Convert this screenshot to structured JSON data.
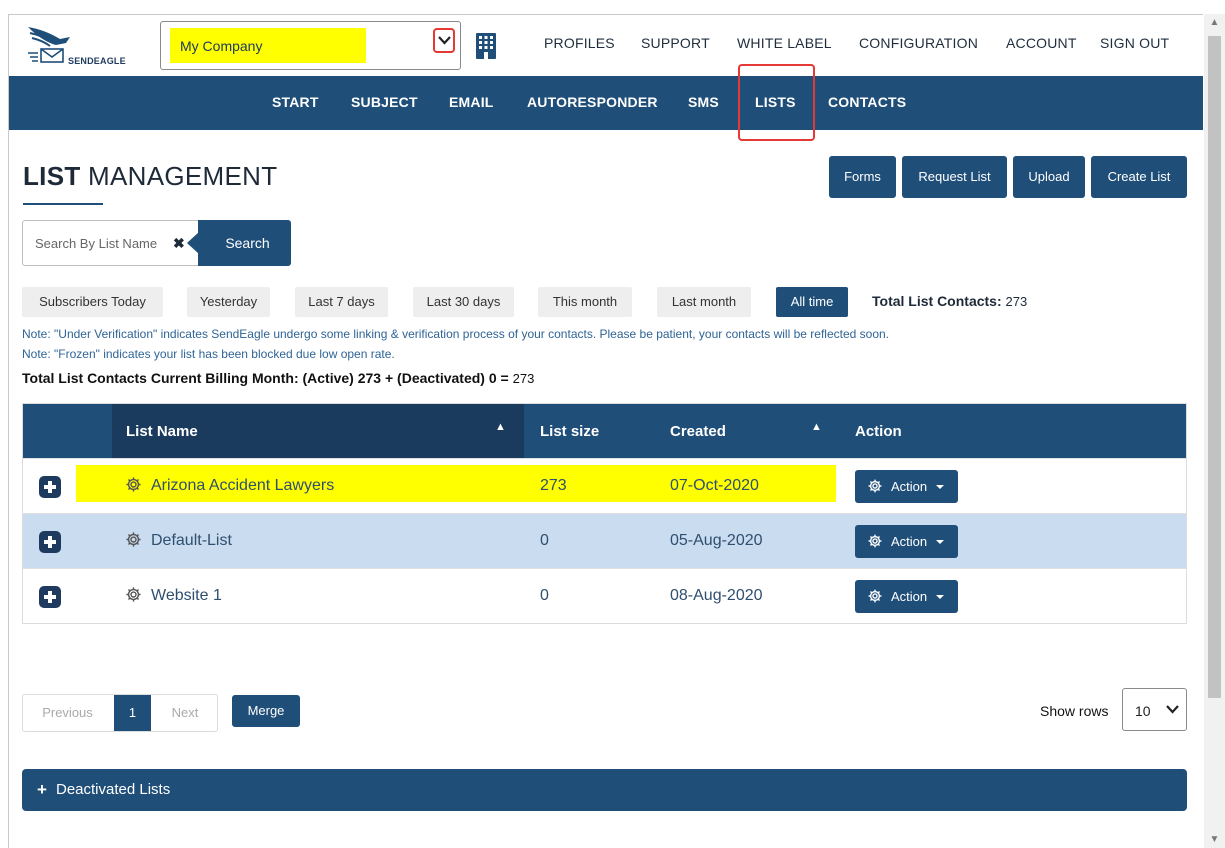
{
  "header": {
    "logo_text": "SENDEAGLE",
    "company": "My Company",
    "nav": [
      "PROFILES",
      "SUPPORT",
      "WHITE LABEL",
      "CONFIGURATION",
      "ACCOUNT",
      "SIGN OUT"
    ]
  },
  "mainnav": [
    "START",
    "SUBJECT",
    "EMAIL",
    "AUTORESPONDER",
    "SMS",
    "LISTS",
    "CONTACTS"
  ],
  "page": {
    "title_bold": "LIST",
    "title_rest": " MANAGEMENT",
    "buttons": [
      "Forms",
      "Request List",
      "Upload",
      "Create List"
    ]
  },
  "search": {
    "placeholder": "Search By List Name",
    "button": "Search"
  },
  "filters": [
    "Subscribers Today",
    "Yesterday",
    "Last 7 days",
    "Last 30 days",
    "This month",
    "Last month",
    "All time"
  ],
  "active_filter": "All time",
  "totals": {
    "label": "Total List Contacts:",
    "value": "273",
    "note1": "Note: \"Under Verification\" indicates SendEagle undergo some linking & verification process of your contacts. Please be patient, your contacts will be reflected soon.",
    "note2": "Note: \"Frozen\" indicates your list has been blocked due low open rate.",
    "billing_label": "Total List Contacts Current Billing Month: (Active) 273 + (Deactivated) 0 =",
    "billing_value": "273"
  },
  "table": {
    "headers": [
      "List Name",
      "List size",
      "Created",
      "Action"
    ],
    "rows": [
      {
        "name": "Arizona Accident Lawyers",
        "size": "273",
        "created": "07-Oct-2020",
        "action": "Action"
      },
      {
        "name": "Default-List",
        "size": "0",
        "created": "05-Aug-2020",
        "action": "Action"
      },
      {
        "name": "Website 1",
        "size": "0",
        "created": "08-Aug-2020",
        "action": "Action"
      }
    ]
  },
  "pagination": {
    "previous": "Previous",
    "current": "1",
    "next": "Next",
    "merge": "Merge",
    "show_rows_label": "Show rows",
    "rows_value": "10"
  },
  "deactivated": "Deactivated Lists",
  "colors": {
    "primary": "#1f4e79",
    "highlight": "#ffff00",
    "alt_row": "#c9dcf0",
    "annotation": "#e53935"
  }
}
